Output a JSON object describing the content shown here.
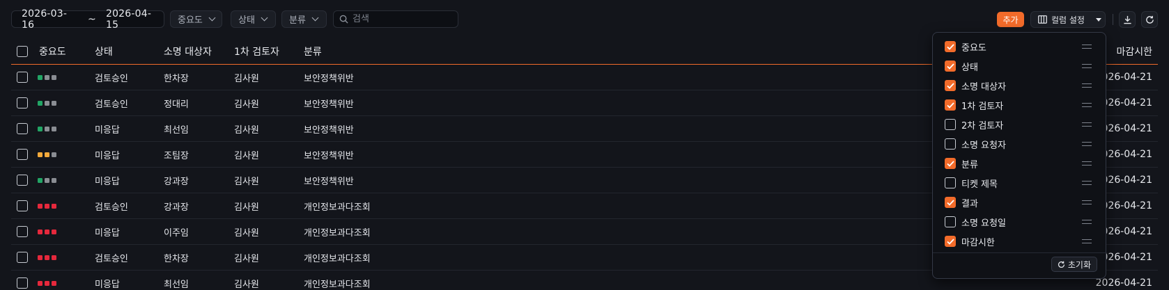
{
  "filters": {
    "date_from": "2026-03-16",
    "date_sep": "~",
    "date_to": "2026-04-15",
    "importance": "중요도",
    "status": "상태",
    "category": "분류",
    "search_placeholder": "검색"
  },
  "toolbar": {
    "add_label": "추가",
    "column_settings_label": "컬럼 설정",
    "download_icon": "download-icon",
    "refresh_icon": "refresh-icon"
  },
  "table": {
    "headers": {
      "importance": "중요도",
      "status": "상태",
      "target": "소명 대상자",
      "reviewer1": "1차 검토자",
      "category": "분류",
      "deadline": "마감시한"
    },
    "rows": [
      {
        "importance": "low",
        "status": "검토승인",
        "target": "한차장",
        "reviewer1": "김사원",
        "category": "보안정책위반",
        "deadline": "2026-04-21"
      },
      {
        "importance": "low",
        "status": "검토승인",
        "target": "정대리",
        "reviewer1": "김사원",
        "category": "보안정책위반",
        "deadline": "2026-04-21"
      },
      {
        "importance": "low",
        "status": "미응답",
        "target": "최선임",
        "reviewer1": "김사원",
        "category": "보안정책위반",
        "deadline": "2026-04-21"
      },
      {
        "importance": "medium",
        "status": "미응답",
        "target": "조팀장",
        "reviewer1": "김사원",
        "category": "보안정책위반",
        "deadline": "2026-04-21"
      },
      {
        "importance": "low",
        "status": "미응답",
        "target": "강과장",
        "reviewer1": "김사원",
        "category": "보안정책위반",
        "deadline": "2026-04-21"
      },
      {
        "importance": "high",
        "status": "검토승인",
        "target": "강과장",
        "reviewer1": "김사원",
        "category": "개인정보과다조회",
        "deadline": "2026-04-21"
      },
      {
        "importance": "high",
        "status": "미응답",
        "target": "이주임",
        "reviewer1": "김사원",
        "category": "개인정보과다조회",
        "deadline": "2026-04-21"
      },
      {
        "importance": "high",
        "status": "검토승인",
        "target": "한차장",
        "reviewer1": "김사원",
        "category": "개인정보과다조회",
        "deadline": "2026-04-21"
      },
      {
        "importance": "high",
        "status": "미응답",
        "target": "최선임",
        "reviewer1": "김사원",
        "category": "개인정보과다조회",
        "deadline": "2026-04-21"
      }
    ]
  },
  "importance_colors": {
    "low": [
      "#22a565",
      "#8a8d93",
      "#8a8d93"
    ],
    "medium": [
      "#f2a93b",
      "#f2a93b",
      "#8a8d93"
    ],
    "high": [
      "#e5283c",
      "#e5283c",
      "#e5283c"
    ]
  },
  "column_panel": {
    "options": [
      {
        "label": "중요도",
        "checked": true
      },
      {
        "label": "상태",
        "checked": true
      },
      {
        "label": "소명 대상자",
        "checked": true
      },
      {
        "label": "1차 검토자",
        "checked": true
      },
      {
        "label": "2차 검토자",
        "checked": false
      },
      {
        "label": "소명 요청자",
        "checked": false
      },
      {
        "label": "분류",
        "checked": true
      },
      {
        "label": "티켓 제목",
        "checked": false
      },
      {
        "label": "결과",
        "checked": true
      },
      {
        "label": "소명 요청일",
        "checked": false
      },
      {
        "label": "마감시한",
        "checked": true
      }
    ],
    "reset_label": "초기화"
  },
  "accent_color": "#f26b2a"
}
